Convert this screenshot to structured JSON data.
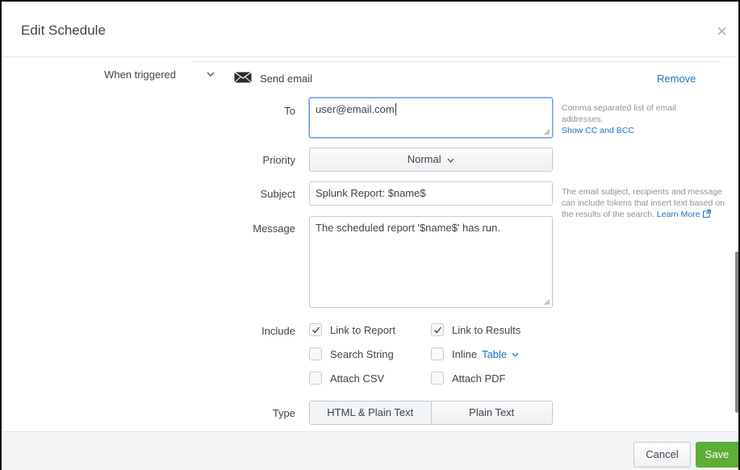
{
  "dialog": {
    "title": "Edit Schedule",
    "close_glyph": "×"
  },
  "action": {
    "when_triggered_label": "When triggered",
    "action_name": "Send email",
    "remove_label": "Remove"
  },
  "email": {
    "to_label": "To",
    "to_value": "user@email.com",
    "to_help": "Comma separated list of email addresses.",
    "show_cc_bcc": "Show CC and BCC",
    "priority_label": "Priority",
    "priority_value": "Normal",
    "subject_label": "Subject",
    "subject_value": "Splunk Report: $name$",
    "message_label": "Message",
    "message_value": "The scheduled report '$name$' has run.",
    "token_help": "The email subject, recipients and message can include tokens that insert text based on the results of the search.",
    "learn_more": "Learn More",
    "include_label": "Include",
    "include": {
      "link_to_report": {
        "label": "Link to Report",
        "checked": true
      },
      "link_to_results": {
        "label": "Link to Results",
        "checked": true
      },
      "search_string": {
        "label": "Search String",
        "checked": false
      },
      "inline": {
        "label": "Inline",
        "checked": false,
        "format": "Table"
      },
      "attach_csv": {
        "label": "Attach CSV",
        "checked": false
      },
      "attach_pdf": {
        "label": "Attach PDF",
        "checked": false
      }
    },
    "type_label": "Type",
    "type_options": [
      "HTML & Plain Text",
      "Plain Text"
    ],
    "type_selected": "HTML & Plain Text"
  },
  "footer": {
    "cancel_label": "Cancel",
    "save_label": "Save"
  },
  "colors": {
    "link": "#1a72c6",
    "save_bg": "#5cae38",
    "focus_border": "#6aa3e0"
  },
  "icons": {
    "collapse": "chevron-down-icon",
    "email": "envelope-icon",
    "external": "external-link-icon",
    "close": "close-icon"
  }
}
